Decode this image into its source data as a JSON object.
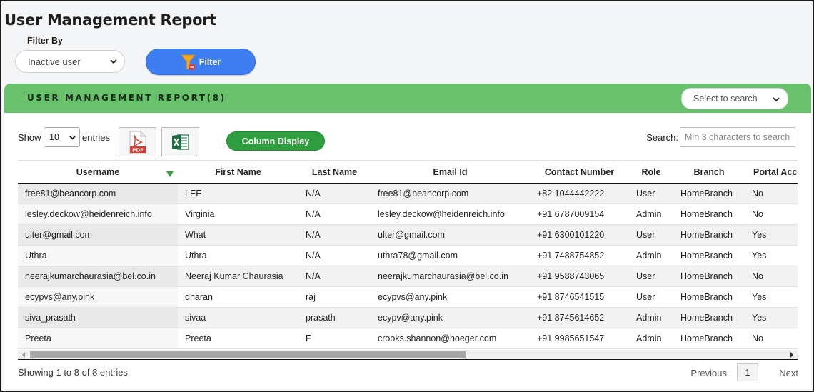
{
  "page": {
    "title": "User Management Report",
    "filter_label": "Filter By",
    "filter_value": "Inactive user",
    "filter_button": "Filter"
  },
  "card": {
    "title": "USER MANAGEMENT REPORT(8)",
    "search_select": "Select to search"
  },
  "toolbar": {
    "show_label": "Show",
    "entries_value": "10",
    "entries_label": "entries",
    "column_display": "Column Display",
    "search_label": "Search:",
    "search_placeholder": "Min 3 characters to search"
  },
  "table": {
    "headers": [
      "Username",
      "First Name",
      "Last Name",
      "Email Id",
      "Contact Number",
      "Role",
      "Branch",
      "Portal Access"
    ],
    "rows": [
      [
        "free81@beancorp.com",
        "LEE",
        "N/A",
        "free81@beancorp.com",
        "+82 1044442222",
        "User",
        "HomeBranch",
        "No"
      ],
      [
        "lesley.deckow@heidenreich.info",
        "Virginia",
        "N/A",
        "lesley.deckow@heidenreich.info",
        "+91 6787009154",
        "Admin",
        "HomeBranch",
        "No"
      ],
      [
        "ulter@gmail.com",
        "What",
        "N/A",
        "ulter@gmail.com",
        "+91 6300101220",
        "User",
        "HomeBranch",
        "Yes"
      ],
      [
        "Uthra",
        "Uthra",
        "N/A",
        "uthra78@gmail.com",
        "+91 7488754852",
        "Admin",
        "HomeBranch",
        "Yes"
      ],
      [
        "neerajkumarchaurasia@bel.co.in",
        "Neeraj Kumar Chaurasia",
        "N/A",
        "neerajkumarchaurasia@bel.co.in",
        "+91 9588743065",
        "User",
        "HomeBranch",
        "No"
      ],
      [
        "ecypvs@any.pink",
        "dharan",
        "raj",
        "ecypvs@any.pink",
        "+91 8746541515",
        "User",
        "HomeBranch",
        "Yes"
      ],
      [
        "siva_prasath",
        "sivaa",
        "prasath",
        "ecypv@any.pink",
        "+91 8745614652",
        "Admin",
        "HomeBranch",
        "Yes"
      ],
      [
        "Preeta",
        "Preeta",
        "F",
        "crooks.shannon@hoeger.com",
        "+91 9985651547",
        "Admin",
        "HomeBranch",
        "No"
      ]
    ]
  },
  "footer": {
    "info": "Showing 1 to 8 of 8 entries",
    "previous": "Previous",
    "page": "1",
    "next": "Next"
  },
  "icons": {
    "filter": "funnel-icon",
    "pdf": "pdf-file-icon",
    "excel": "excel-file-icon",
    "sort": "sort-desc-icon"
  },
  "colors": {
    "header_green": "#68c26c",
    "filter_blue": "#3d7ff2",
    "column_btn_green": "#2e9e3f"
  }
}
